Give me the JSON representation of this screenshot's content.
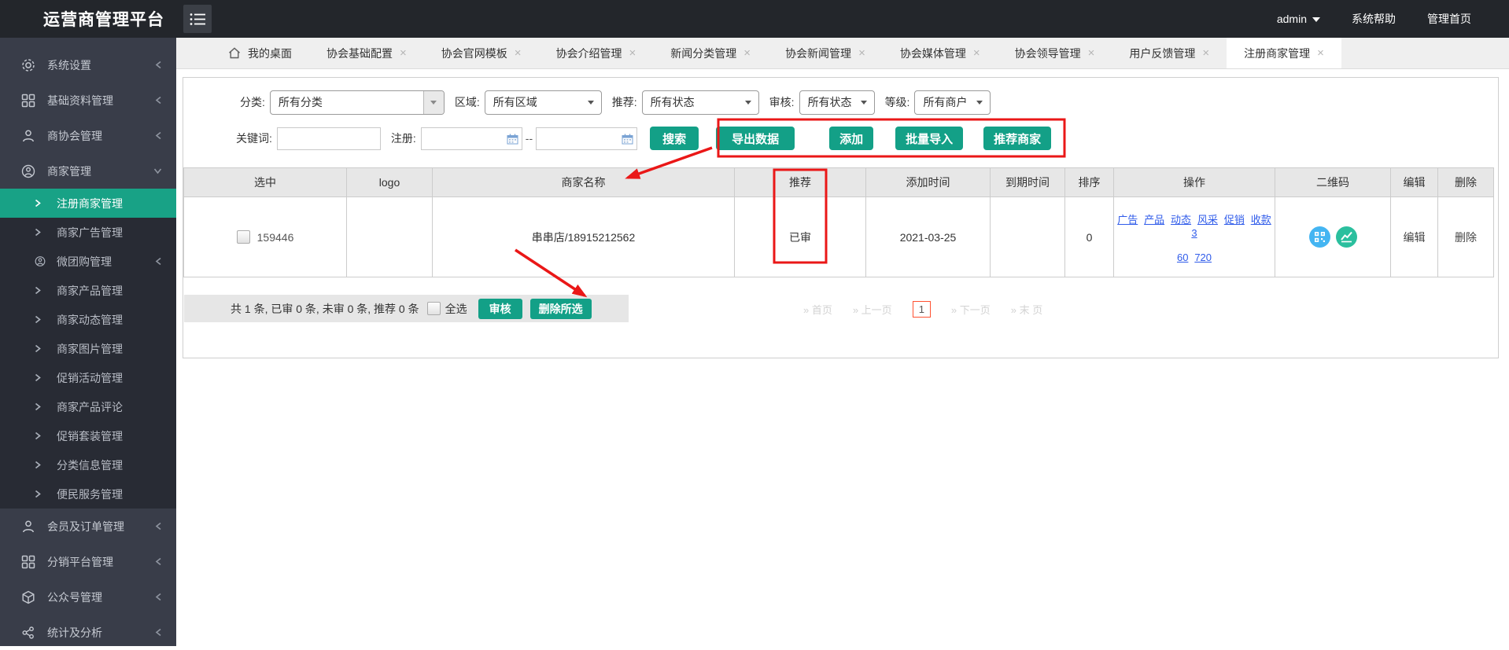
{
  "topbar": {
    "brand": "运营商管理平台",
    "user": "admin",
    "help": "系统帮助",
    "home": "管理首页"
  },
  "sidebar": {
    "items": [
      {
        "label": "系统设置",
        "icon": "gear-icon",
        "level": "top"
      },
      {
        "label": "基础资料管理",
        "icon": "grid-icon",
        "level": "top"
      },
      {
        "label": "商协会管理",
        "icon": "person-icon",
        "level": "top"
      },
      {
        "label": "商家管理",
        "icon": "person-circle-icon",
        "level": "top",
        "expanded": true
      },
      {
        "label": "注册商家管理",
        "level": "sub",
        "active": true
      },
      {
        "label": "商家广告管理",
        "level": "sub"
      },
      {
        "label": "微团购管理",
        "level": "sub",
        "icon": "person-circle-icon"
      },
      {
        "label": "商家产品管理",
        "level": "sub"
      },
      {
        "label": "商家动态管理",
        "level": "sub"
      },
      {
        "label": "商家图片管理",
        "level": "sub"
      },
      {
        "label": "促销活动管理",
        "level": "sub"
      },
      {
        "label": "商家产品评论",
        "level": "sub"
      },
      {
        "label": "促销套装管理",
        "level": "sub"
      },
      {
        "label": "分类信息管理",
        "level": "sub"
      },
      {
        "label": "便民服务管理",
        "level": "sub"
      },
      {
        "label": "会员及订单管理",
        "icon": "person-icon",
        "level": "top"
      },
      {
        "label": "分销平台管理",
        "icon": "grid-icon",
        "level": "top"
      },
      {
        "label": "公众号管理",
        "icon": "cube-icon",
        "level": "top"
      },
      {
        "label": "统计及分析",
        "icon": "stats-icon",
        "level": "top"
      }
    ]
  },
  "ui": {
    "close_glyph": "×"
  },
  "tabs": [
    {
      "label": "我的桌面",
      "closable": false
    },
    {
      "label": "协会基础配置",
      "closable": true
    },
    {
      "label": "协会官网模板",
      "closable": true
    },
    {
      "label": "协会介绍管理",
      "closable": true
    },
    {
      "label": "新闻分类管理",
      "closable": true
    },
    {
      "label": "协会新闻管理",
      "closable": true
    },
    {
      "label": "协会媒体管理",
      "closable": true
    },
    {
      "label": "协会领导管理",
      "closable": true
    },
    {
      "label": "用户反馈管理",
      "closable": true
    },
    {
      "label": "注册商家管理",
      "closable": true,
      "active": true
    }
  ],
  "filters": {
    "category_label": "分类:",
    "category": "所有分类",
    "region_label": "区域:",
    "region": "所有区域",
    "recommend_label": "推荐:",
    "recommend": "所有状态",
    "audit_label": "审核:",
    "audit": "所有状态",
    "level_label": "等级:",
    "level": "所有商户",
    "keyword_label": "关键词:",
    "keyword_value": "",
    "register_label": "注册:",
    "range_sep": "--",
    "search": "搜索",
    "export": "导出数据",
    "add": "添加",
    "batch_import": "批量导入",
    "recommend_btn": "推荐商家"
  },
  "table": {
    "columns": [
      "选中",
      "logo",
      "商家名称",
      "推荐",
      "添加时间",
      "到期时间",
      "排序",
      "操作",
      "二维码",
      "编辑",
      "删除"
    ],
    "row": {
      "id": "159446",
      "logo": "",
      "name": "串串店/18915212562",
      "status": "已审",
      "added": "2021-03-25",
      "expire": "",
      "sort": "0",
      "op_links": [
        "广告",
        "产品",
        "动态",
        "风采",
        "促销",
        "收款",
        "3"
      ],
      "op_links2": [
        "60",
        "720"
      ],
      "edit": "编辑",
      "del": "删除"
    }
  },
  "footer": {
    "summary": "共 1 条, 已审 0 条, 未审 0 条, 推荐 0 条",
    "select_all": "全选",
    "audit_btn": "审核",
    "delete_btn": "删除所选"
  },
  "pagination": {
    "first": "» 首页",
    "prev": "» 上一页",
    "current": "1",
    "next": "» 下一页",
    "last": "» 末 页"
  },
  "colors": {
    "topbar_bg": "#23262b",
    "sidebar_bg": "#393d49",
    "submenu_bg": "#282b34",
    "active_teal": "#18a286",
    "button_teal": "#13a087",
    "link_blue": "#2f5bea",
    "status_green": "#2aa62a",
    "annotation_red": "#ea1717",
    "pager_current_border": "#ff5131"
  }
}
